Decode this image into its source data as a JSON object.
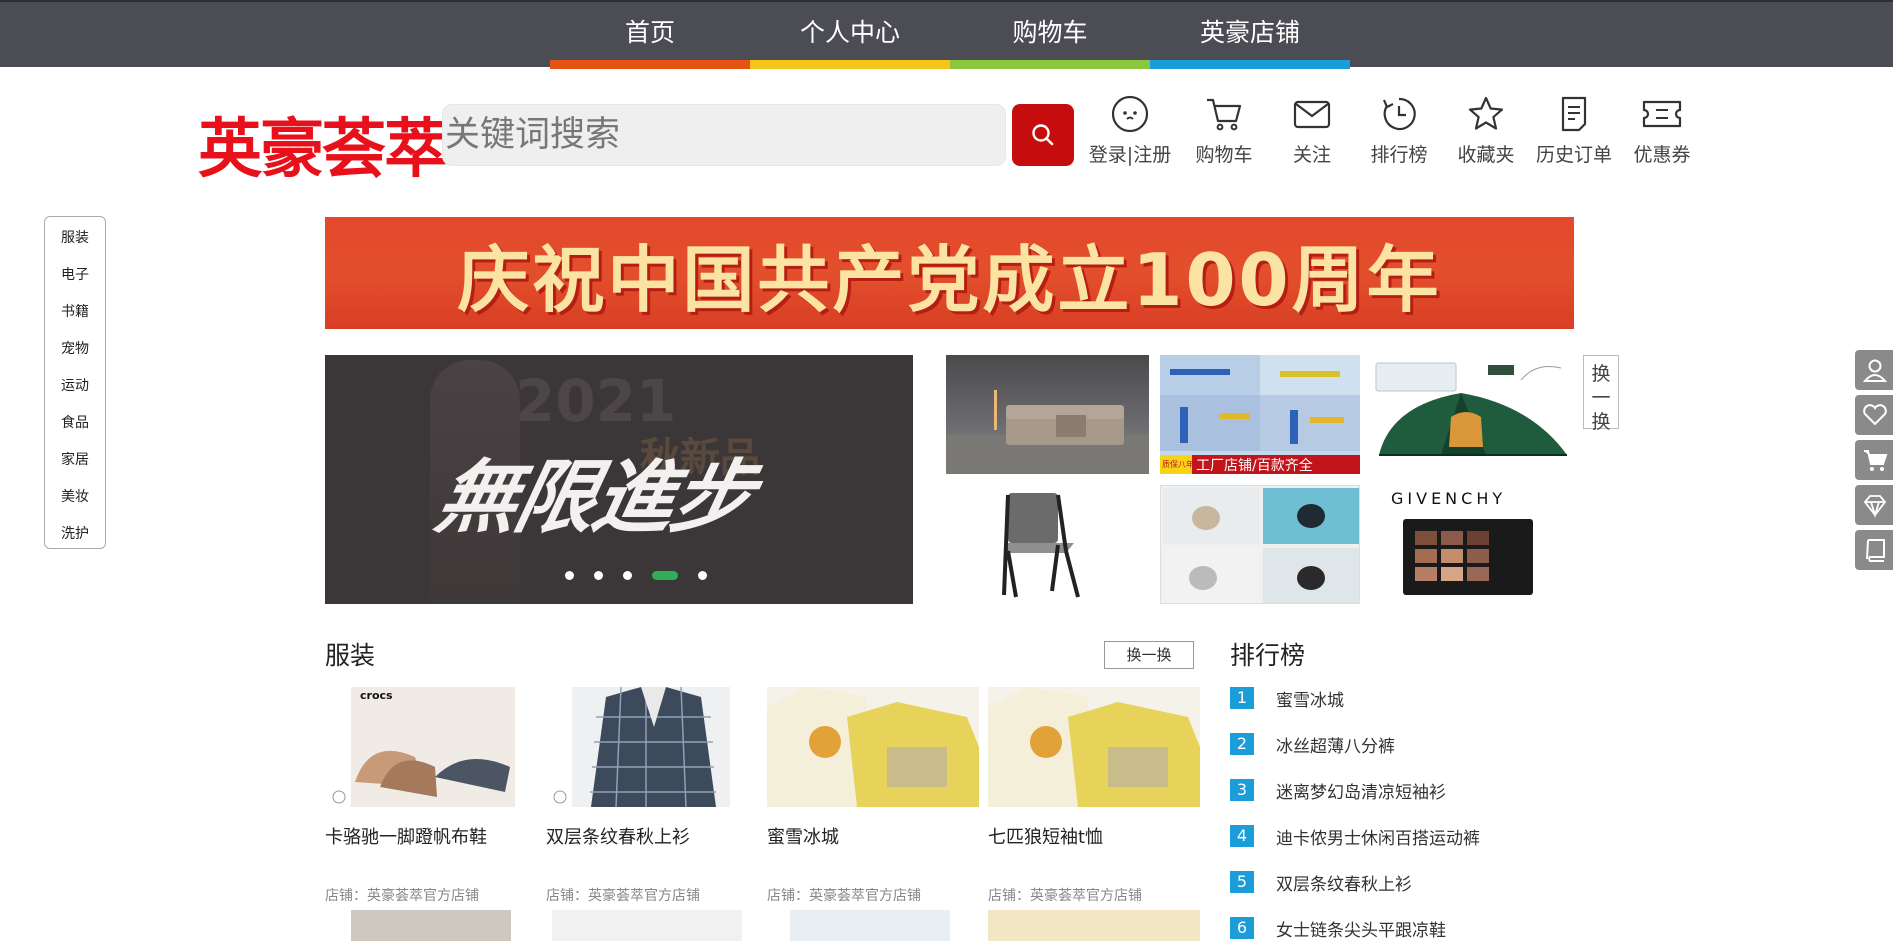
{
  "nav": {
    "items": [
      {
        "label": "首页",
        "color": "#e55314"
      },
      {
        "label": "个人中心",
        "color": "#f5c518"
      },
      {
        "label": "购物车",
        "color": "#8cc63f"
      },
      {
        "label": "英豪店铺",
        "color": "#1a9ddb"
      }
    ]
  },
  "header": {
    "logo": "英豪荟萃",
    "search_placeholder": "关键词搜索",
    "icons": [
      {
        "label": "登录|注册",
        "icon": "face-icon"
      },
      {
        "label": "购物车",
        "icon": "cart-icon"
      },
      {
        "label": "关注",
        "icon": "mail-icon"
      },
      {
        "label": "排行榜",
        "icon": "history-icon"
      },
      {
        "label": "收藏夹",
        "icon": "star-icon"
      },
      {
        "label": "历史订单",
        "icon": "order-icon"
      },
      {
        "label": "优惠券",
        "icon": "ticket-icon"
      }
    ]
  },
  "categories": [
    "服装",
    "电子",
    "书籍",
    "宠物",
    "运动",
    "食品",
    "家居",
    "美妆",
    "洗护"
  ],
  "banner": {
    "text": "庆祝中国共产党成立100周年"
  },
  "carousel": {
    "ghost_year": "2021",
    "ghost_sub": "秋新品",
    "slogan": "無限進步",
    "active_index": 3,
    "dot_count": 5
  },
  "thumbs_swap": "换一换",
  "thumb_texts": {
    "factory": "工厂店铺/百款齐全",
    "badge": "质保八年",
    "givenchy": "GIVENCHY"
  },
  "clothing": {
    "title": "服装",
    "swap_label": "换一换",
    "products": [
      {
        "name": "卡骆驰一脚蹬帆布鞋",
        "shop": "店铺：英豪荟萃官方店铺",
        "brand": "crocs"
      },
      {
        "name": "双层条纹春秋上衫",
        "shop": "店铺：英豪荟萃官方店铺"
      },
      {
        "name": "蜜雪冰城",
        "shop": "店铺：英豪荟萃官方店铺"
      },
      {
        "name": "七匹狼短袖t恤",
        "shop": "店铺：英豪荟萃官方店铺"
      }
    ]
  },
  "ranking": {
    "title": "排行榜",
    "items": [
      {
        "num": "1",
        "name": "蜜雪冰城"
      },
      {
        "num": "2",
        "name": "冰丝超薄八分裤"
      },
      {
        "num": "3",
        "name": "迷离梦幻岛清凉短袖衫"
      },
      {
        "num": "4",
        "name": "迪卡侬男士休闲百搭运动裤"
      },
      {
        "num": "5",
        "name": "双层条纹春秋上衫"
      },
      {
        "num": "6",
        "name": "女士链条尖头平跟凉鞋"
      }
    ]
  }
}
